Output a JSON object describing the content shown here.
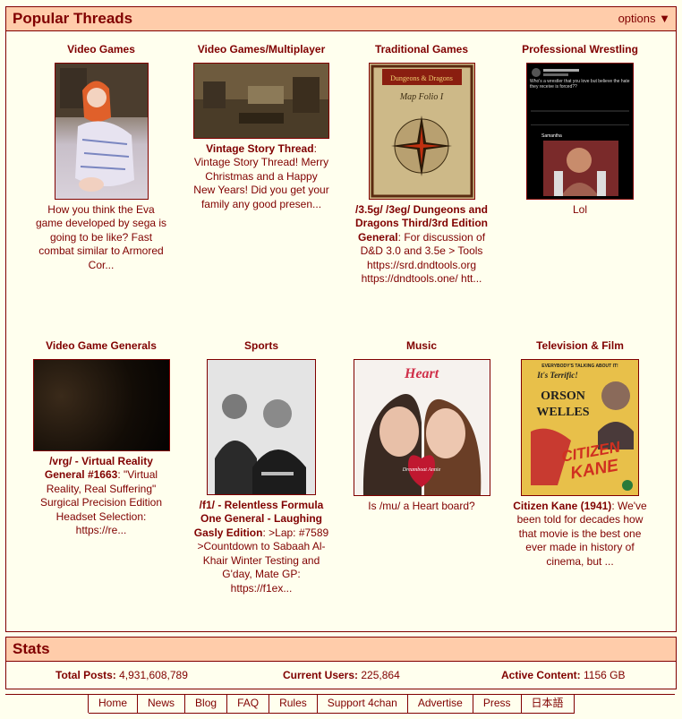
{
  "popular": {
    "title": "Popular Threads",
    "options_label": "options",
    "options_icon": "triangle-down-icon",
    "row1": [
      {
        "board": "Video Games",
        "teaser": "How you think the Eva game developed by sega is going to be like? Fast combat similar to Armored Cor..."
      },
      {
        "board": "Video Games/Multiplayer",
        "subject": "Vintage Story Thread",
        "teaser": ": Vintage Story Thread! Merry Christmas and a Happy New Years! Did you get your family any good presen..."
      },
      {
        "board": "Traditional Games",
        "subject": "/3.5g/ /3eg/ Dungeons and Dragons Third/3rd Edition General",
        "teaser": ": For discussion of D&D 3.0 and 3.5e > Tools https://srd.dndtools.org https://dndtools.one/ htt...",
        "cover_brand": "Dungeons & Dragons",
        "cover_title": "Map Folio I"
      },
      {
        "board": "Professional Wrestling",
        "teaser": "Lol",
        "tweet_text": "Who's a wrestler that you love but believe the hate they receive is forced??",
        "tweet_reply": "Samantha"
      }
    ],
    "row2": [
      {
        "board": "Video Game Generals",
        "subject": "/vrg/ - Virtual Reality General #1663",
        "teaser": ": \"Virtual Reality, Real Suffering\" Surgical Precision Edition Headset Selection: https://re..."
      },
      {
        "board": "Sports",
        "subject": "/f1/ - Relentless Formula One General - Laughing Gasly Edition",
        "teaser": ": >Lap: #7589 >Countdown to Sabaah Al-Khair Winter Testing and G'day, Mate GP: https://f1ex..."
      },
      {
        "board": "Music",
        "teaser": "Is /mu/ a Heart board?",
        "cover_band": "Heart",
        "cover_album": "Dreamboat Annie"
      },
      {
        "board": "Television & Film",
        "subject": "Citizen Kane (1941)",
        "teaser": ": We've been told for decades how that movie is the best one ever made in history of cinema, but ...",
        "poster_top": "EVERYBODY'S TALKING ABOUT IT!",
        "poster_tag": "It's Terrific!",
        "poster_star1": "ORSON",
        "poster_star2": "WELLES",
        "poster_title1": "CITIZEN",
        "poster_title2": "KANE"
      }
    ]
  },
  "stats": {
    "title": "Stats",
    "posts_label": "Total Posts:",
    "posts_value": "4,931,608,789",
    "users_label": "Current Users:",
    "users_value": "225,864",
    "content_label": "Active Content:",
    "content_value": "1156 GB"
  },
  "footer": {
    "links": [
      "Home",
      "News",
      "Blog",
      "FAQ",
      "Rules",
      "Support 4chan",
      "Advertise",
      "Press",
      "日本語"
    ]
  },
  "colors": {
    "maroon": "#800000",
    "header_bg": "#ffccaa",
    "page_bg": "#ffffee"
  }
}
